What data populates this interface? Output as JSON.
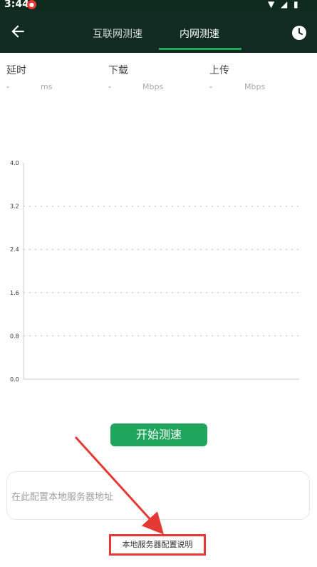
{
  "status_bar": {
    "time": "3:44"
  },
  "tabs": [
    {
      "label": "互联网测速",
      "selected": false
    },
    {
      "label": "内网测速",
      "selected": true
    }
  ],
  "metrics": [
    {
      "label": "延时",
      "value": "-",
      "unit": "ms"
    },
    {
      "label": "下载",
      "value": "-",
      "unit": "Mbps"
    },
    {
      "label": "上传",
      "value": "-",
      "unit": "Mbps"
    }
  ],
  "chart_data": {
    "type": "line",
    "ylim": [
      0,
      4.0
    ],
    "yticks": [
      "4.0",
      "3.2",
      "2.4",
      "1.6",
      "0.8",
      "0.0"
    ],
    "grid": true,
    "series": []
  },
  "start_button": {
    "label": "开始测速"
  },
  "server_input": {
    "value": "",
    "placeholder": "在此配置本地服务器地址"
  },
  "help_link": {
    "label": "本地服务器配置说明"
  },
  "colors": {
    "accent": "#1fa65c",
    "appbar": "#122b22",
    "annotation": "#e53935"
  },
  "icons": [
    "back-arrow-icon",
    "history-clock-icon",
    "wifi-icon",
    "signal-icon",
    "battery-icon",
    "notification-icon"
  ]
}
